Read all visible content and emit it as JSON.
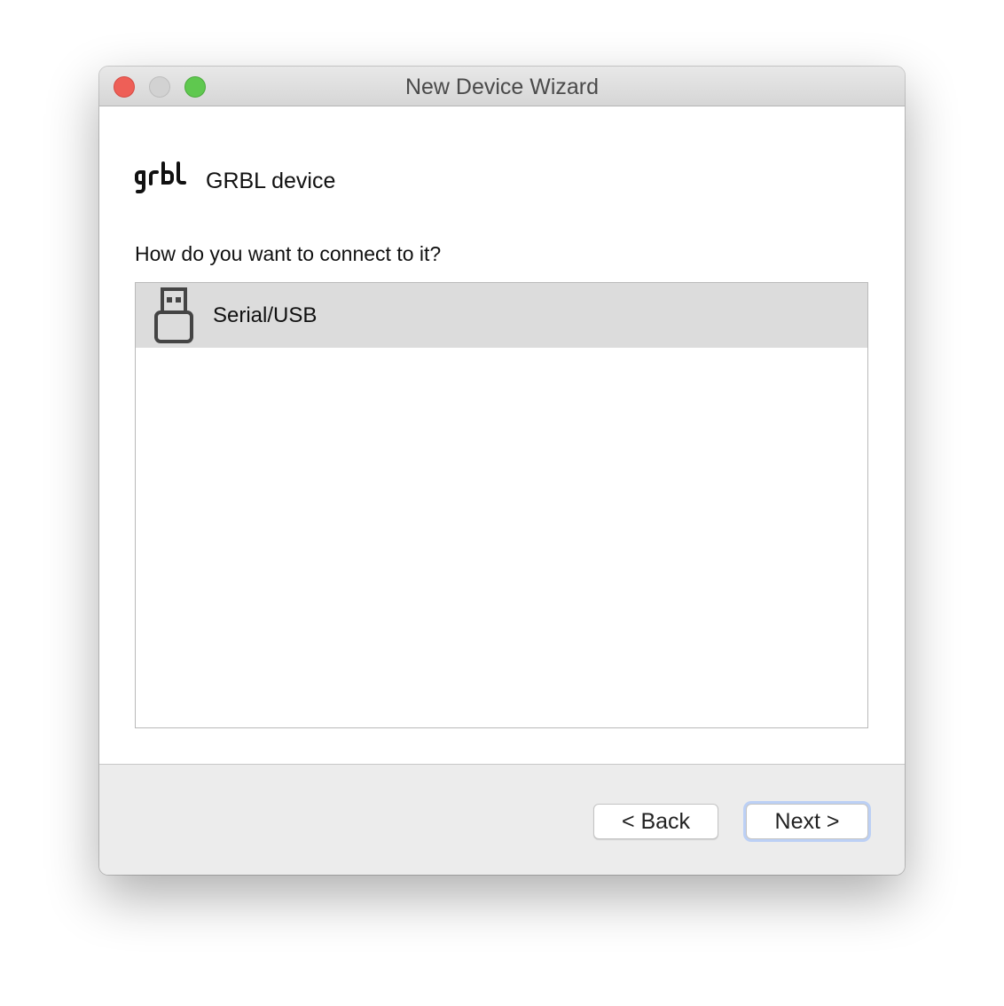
{
  "window": {
    "title": "New Device Wizard"
  },
  "header": {
    "logo_text": "grbl",
    "device_name": "GRBL device"
  },
  "prompt": {
    "question": "How do you want to connect to it?"
  },
  "connection_list": {
    "items": [
      {
        "label": "Serial/USB",
        "icon": "usb-icon",
        "selected": true
      }
    ]
  },
  "footer": {
    "back_label": "< Back",
    "next_label": "Next >"
  },
  "colors": {
    "close": "#ee5f57",
    "minimize": "#d2d2d2",
    "zoom": "#5fc84f",
    "selection": "#dcdcdc",
    "focus_ring": "#bcd0f5"
  }
}
